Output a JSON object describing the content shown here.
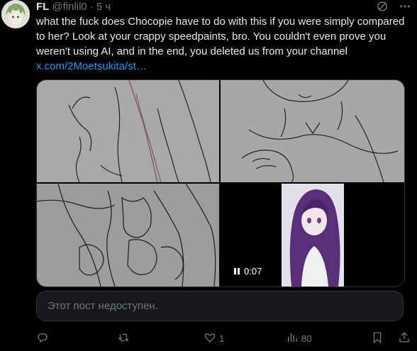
{
  "tweet": {
    "author_name": "FL",
    "author_handle": "@finlil0",
    "separator": "·",
    "time": "5 ч",
    "text": "what the fuck does Chocopie have to do with this if you were simply compared to her? Look at your crappy speedpaints, bro. You couldn't even prove you weren't using AI, and in the end, you deleted us from your channel ",
    "link_text": "x.com/2Moetsukita/st…"
  },
  "media": {
    "video_duration": "0:07"
  },
  "quoted_post": {
    "unavailable_text": "Этот пост недоступен."
  },
  "actions": {
    "reply_count": "",
    "retweet_count": "",
    "like_count": "1",
    "views_count": "80"
  },
  "colors": {
    "background": "#000000",
    "text": "#e7e9ea",
    "muted": "#71767b",
    "link": "#1d9bf0",
    "border": "#2f3336"
  }
}
